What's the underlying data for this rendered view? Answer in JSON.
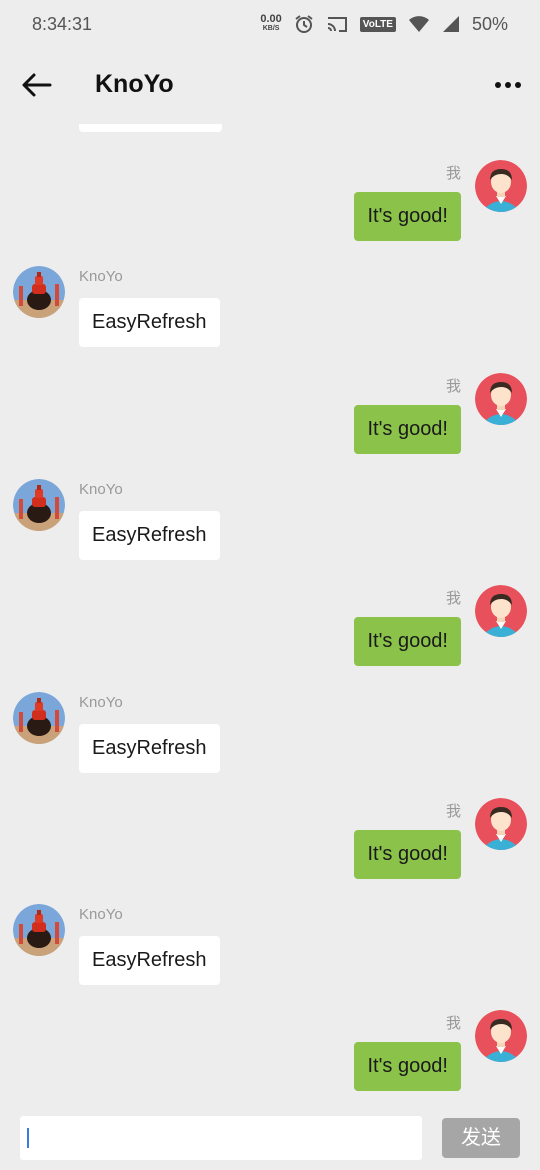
{
  "status": {
    "time": "8:34:31",
    "net_speed_value": "0.00",
    "net_speed_unit": "KB/S",
    "volte": "VoLTE",
    "battery": "50%"
  },
  "toolbar": {
    "title": "KnoYo"
  },
  "messages": [
    {
      "side": "me",
      "sender": "我",
      "text": "It's good!"
    },
    {
      "side": "other",
      "sender": "KnoYo",
      "text": "EasyRefresh"
    },
    {
      "side": "me",
      "sender": "我",
      "text": "It's good!"
    },
    {
      "side": "other",
      "sender": "KnoYo",
      "text": "EasyRefresh"
    },
    {
      "side": "me",
      "sender": "我",
      "text": "It's good!"
    },
    {
      "side": "other",
      "sender": "KnoYo",
      "text": "EasyRefresh"
    },
    {
      "side": "me",
      "sender": "我",
      "text": "It's good!"
    },
    {
      "side": "other",
      "sender": "KnoYo",
      "text": "EasyRefresh"
    },
    {
      "side": "me",
      "sender": "我",
      "text": "It's good!"
    }
  ],
  "input": {
    "value": "",
    "send_label": "发送"
  },
  "colors": {
    "me_bubble": "#8bc34a",
    "other_bubble": "#ffffff",
    "background": "#ededed",
    "send_button": "#a6a6a6"
  }
}
